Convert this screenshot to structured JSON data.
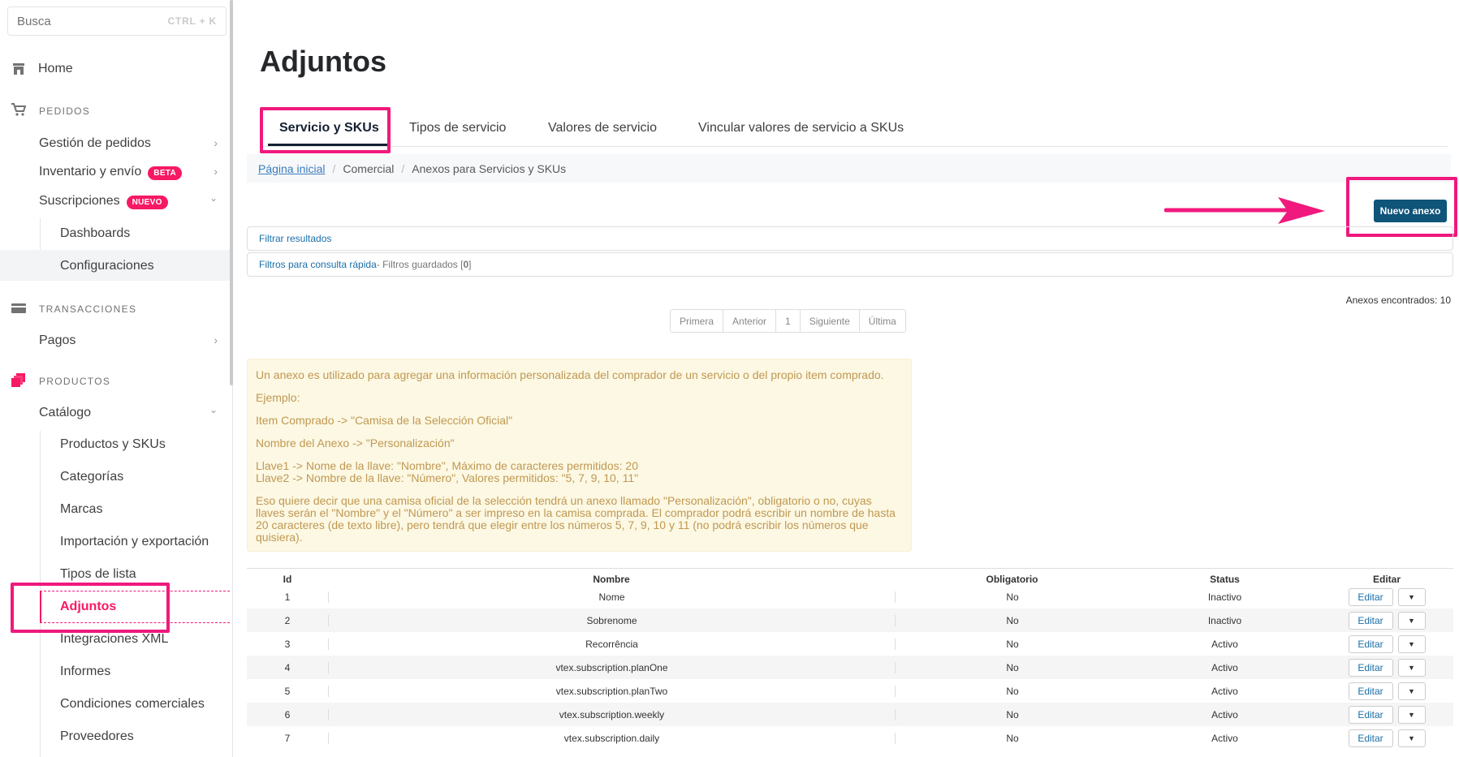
{
  "search": {
    "placeholder": "Busca",
    "shortcut": "CTRL + K"
  },
  "sidebar": {
    "home": "Home",
    "sections": [
      {
        "label": "PEDIDOS",
        "icon": "cart-icon"
      },
      {
        "label": "TRANSACCIONES",
        "icon": "card-icon"
      },
      {
        "label": "PRODUCTOS",
        "icon": "products-icon"
      }
    ],
    "pedidos": [
      {
        "label": "Gestión de pedidos"
      },
      {
        "label": "Inventario y envío",
        "badge": "BETA"
      },
      {
        "label": "Suscripciones",
        "badge": "NUEVO"
      }
    ],
    "suscripciones_sub": [
      "Dashboards",
      "Configuraciones"
    ],
    "pagos": "Pagos",
    "catalogo": "Catálogo",
    "catalogo_sub": [
      "Productos y SKUs",
      "Categorías",
      "Marcas",
      "Importación y exportación",
      "Tipos de lista",
      "Adjuntos",
      "Integraciones XML",
      "Informes",
      "Condiciones comerciales",
      "Proveedores"
    ],
    "active_item": "Adjuntos"
  },
  "page": {
    "title": "Adjuntos"
  },
  "tabs": [
    "Servicio y SKUs",
    "Tipos de servicio",
    "Valores de servicio",
    "Vincular valores de servicio a SKUs"
  ],
  "breadcrumb": [
    "Página inicial",
    "Comercial",
    "Anexos para Servicios y SKUs"
  ],
  "actions": {
    "new_label": "Nuevo anexo"
  },
  "filters": {
    "filter_results": "Filtrar resultados",
    "quick_filters": "Filtros para consulta rápida",
    "saved_prefix": " - Filtros guardados [",
    "saved_count": "0",
    "saved_suffix": "]"
  },
  "found": "Anexos encontrados: 10",
  "pagination": [
    "Primera",
    "Anterior",
    "1",
    "Siguiente",
    "Última"
  ],
  "info": [
    "Un anexo es utilizado para agregar una información personalizada del comprador de un servicio o del propio item comprado.",
    "Ejemplo:",
    "Item Comprado -> \"Camisa de la Selección Oficial\"",
    "Nombre del Anexo -> \"Personalización\"",
    "Llave1 -> Nome de la llave: \"Nombre\", Máximo de caracteres permitidos: 20",
    "Llave2 -> Nombre de la llave: \"Número\", Valores permitidos: \"5, 7, 9, 10, 11\"",
    "Eso quiere decir que una camisa oficial de la selección tendrá un anexo llamado \"Personalización\", obligatorio o no, cuyas llaves serán el \"Nombre\" y el \"Número\" a ser impreso en la camisa comprada. El comprador podrá escribir un nombre de hasta 20 caracteres (de texto libre), pero tendrá que elegir entre los números 5, 7, 9, 10 y 11 (no podrá escribir los números que quisiera)."
  ],
  "table": {
    "columns": [
      "Id",
      "Nombre",
      "Obligatorio",
      "Status",
      "Editar"
    ],
    "edit_label": "Editar",
    "rows": [
      {
        "id": "1",
        "nombre": "Nome",
        "obligatorio": "No",
        "status": "Inactivo"
      },
      {
        "id": "2",
        "nombre": "Sobrenome",
        "obligatorio": "No",
        "status": "Inactivo"
      },
      {
        "id": "3",
        "nombre": "Recorrência",
        "obligatorio": "No",
        "status": "Activo"
      },
      {
        "id": "4",
        "nombre": "vtex.subscription.planOne",
        "obligatorio": "No",
        "status": "Activo"
      },
      {
        "id": "5",
        "nombre": "vtex.subscription.planTwo",
        "obligatorio": "No",
        "status": "Activo"
      },
      {
        "id": "6",
        "nombre": "vtex.subscription.weekly",
        "obligatorio": "No",
        "status": "Activo"
      },
      {
        "id": "7",
        "nombre": "vtex.subscription.daily",
        "obligatorio": "No",
        "status": "Activo"
      }
    ]
  },
  "colors": {
    "accent": "#f71963",
    "highlight": "#f0197d",
    "primary_button": "#0f5479",
    "info_bg": "#fcf8e3",
    "info_text": "#c09853"
  }
}
